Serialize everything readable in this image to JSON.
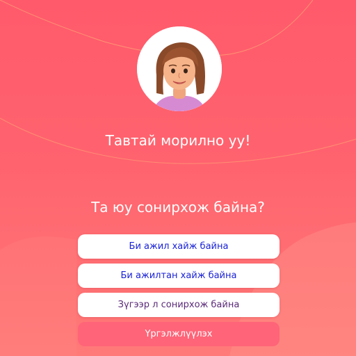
{
  "welcome": {
    "avatar_icon": "woman-avatar-icon",
    "title": "Тавтай морилно уу!",
    "question": "Та юу сонирхож байна?",
    "options": [
      {
        "label": "Би ажил хайж байна"
      },
      {
        "label": "Би ажилтан хайж байна"
      },
      {
        "label": "Зүгээр л сонирхож байна"
      }
    ],
    "continue_label": "Үргэлжлүүлэх"
  },
  "colors": {
    "background": "#ff5a6b",
    "option_text": "#1a22d6",
    "continue_button": "#ff6478"
  }
}
